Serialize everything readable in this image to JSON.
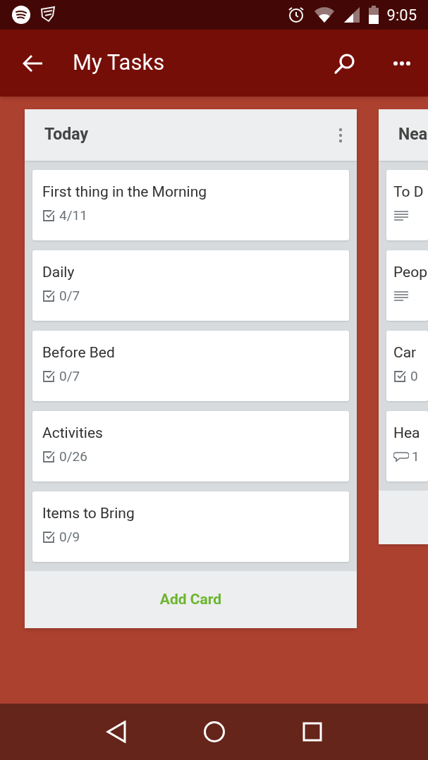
{
  "status_bar": {
    "time": "9:05"
  },
  "app_bar": {
    "title": "My Tasks"
  },
  "lists": [
    {
      "title": "Today",
      "add_label": "Add Card",
      "cards": [
        {
          "title": "First thing in the Morning",
          "badge": {
            "kind": "checklist",
            "text": "4/11"
          }
        },
        {
          "title": "Daily",
          "badge": {
            "kind": "checklist",
            "text": "0/7"
          }
        },
        {
          "title": "Before Bed",
          "badge": {
            "kind": "checklist",
            "text": "0/7"
          }
        },
        {
          "title": "Activities",
          "badge": {
            "kind": "checklist",
            "text": "0/26"
          }
        },
        {
          "title": "Items to Bring",
          "badge": {
            "kind": "checklist",
            "text": "0/9"
          }
        }
      ]
    },
    {
      "title": "Nea",
      "cards": [
        {
          "title": "To D",
          "badge": {
            "kind": "description"
          }
        },
        {
          "title": "Peop",
          "badge": {
            "kind": "description"
          }
        },
        {
          "title": "Car",
          "badge": {
            "kind": "checklist",
            "text": "0"
          }
        },
        {
          "title": "Hea",
          "badge": {
            "kind": "comments",
            "text": "1"
          }
        }
      ]
    }
  ]
}
